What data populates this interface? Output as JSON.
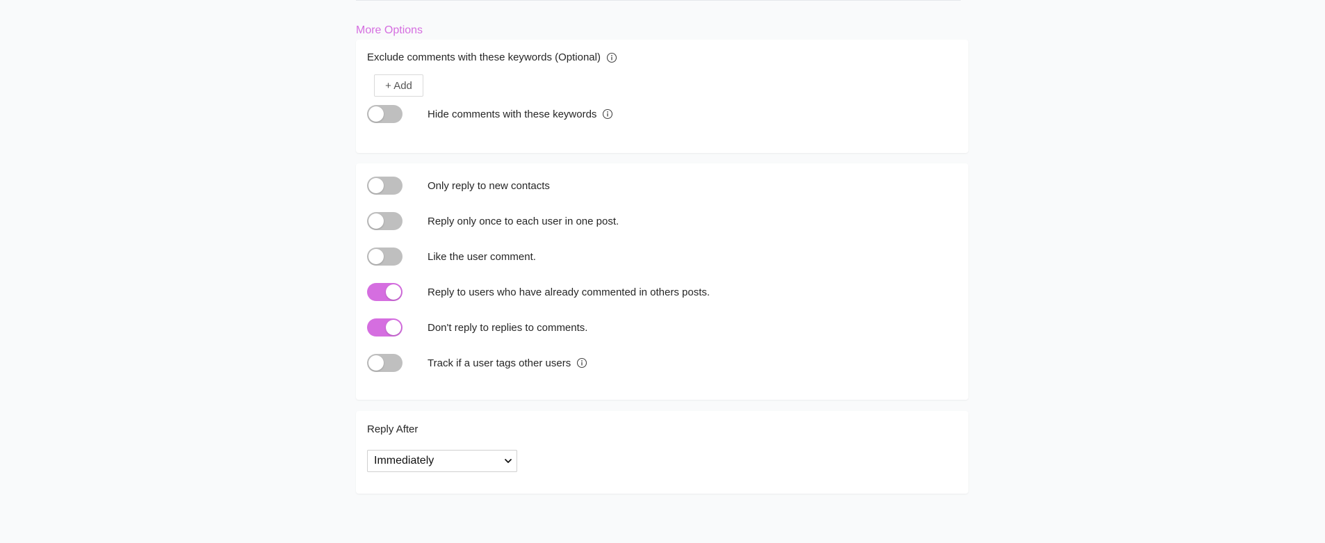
{
  "more_options": {
    "title": "More Options"
  },
  "keywords_card": {
    "exclude_label": "Exclude comments with these keywords (Optional)",
    "add_button_label": "+ Add",
    "hide_toggle": {
      "label": "Hide comments with these keywords",
      "on": false
    }
  },
  "reply_options": {
    "toggles": [
      {
        "label": "Only reply to new contacts",
        "on": false
      },
      {
        "label": "Reply only once to each user in one post.",
        "on": false
      },
      {
        "label": "Like the user comment.",
        "on": false
      },
      {
        "label": "Reply to users who have already commented in others posts.",
        "on": true
      },
      {
        "label": "Don't reply to replies to comments.",
        "on": true
      },
      {
        "label": "Track if a user tags other users",
        "on": false
      }
    ]
  },
  "reply_after": {
    "label": "Reply After",
    "selected": "Immediately"
  },
  "colors": {
    "accent": "#d56ee0",
    "toggle_off": "#bfbfbf",
    "background": "#f9fafb"
  },
  "icons": {
    "info": "info-circle-icon",
    "chevron": "chevron-down-icon"
  }
}
